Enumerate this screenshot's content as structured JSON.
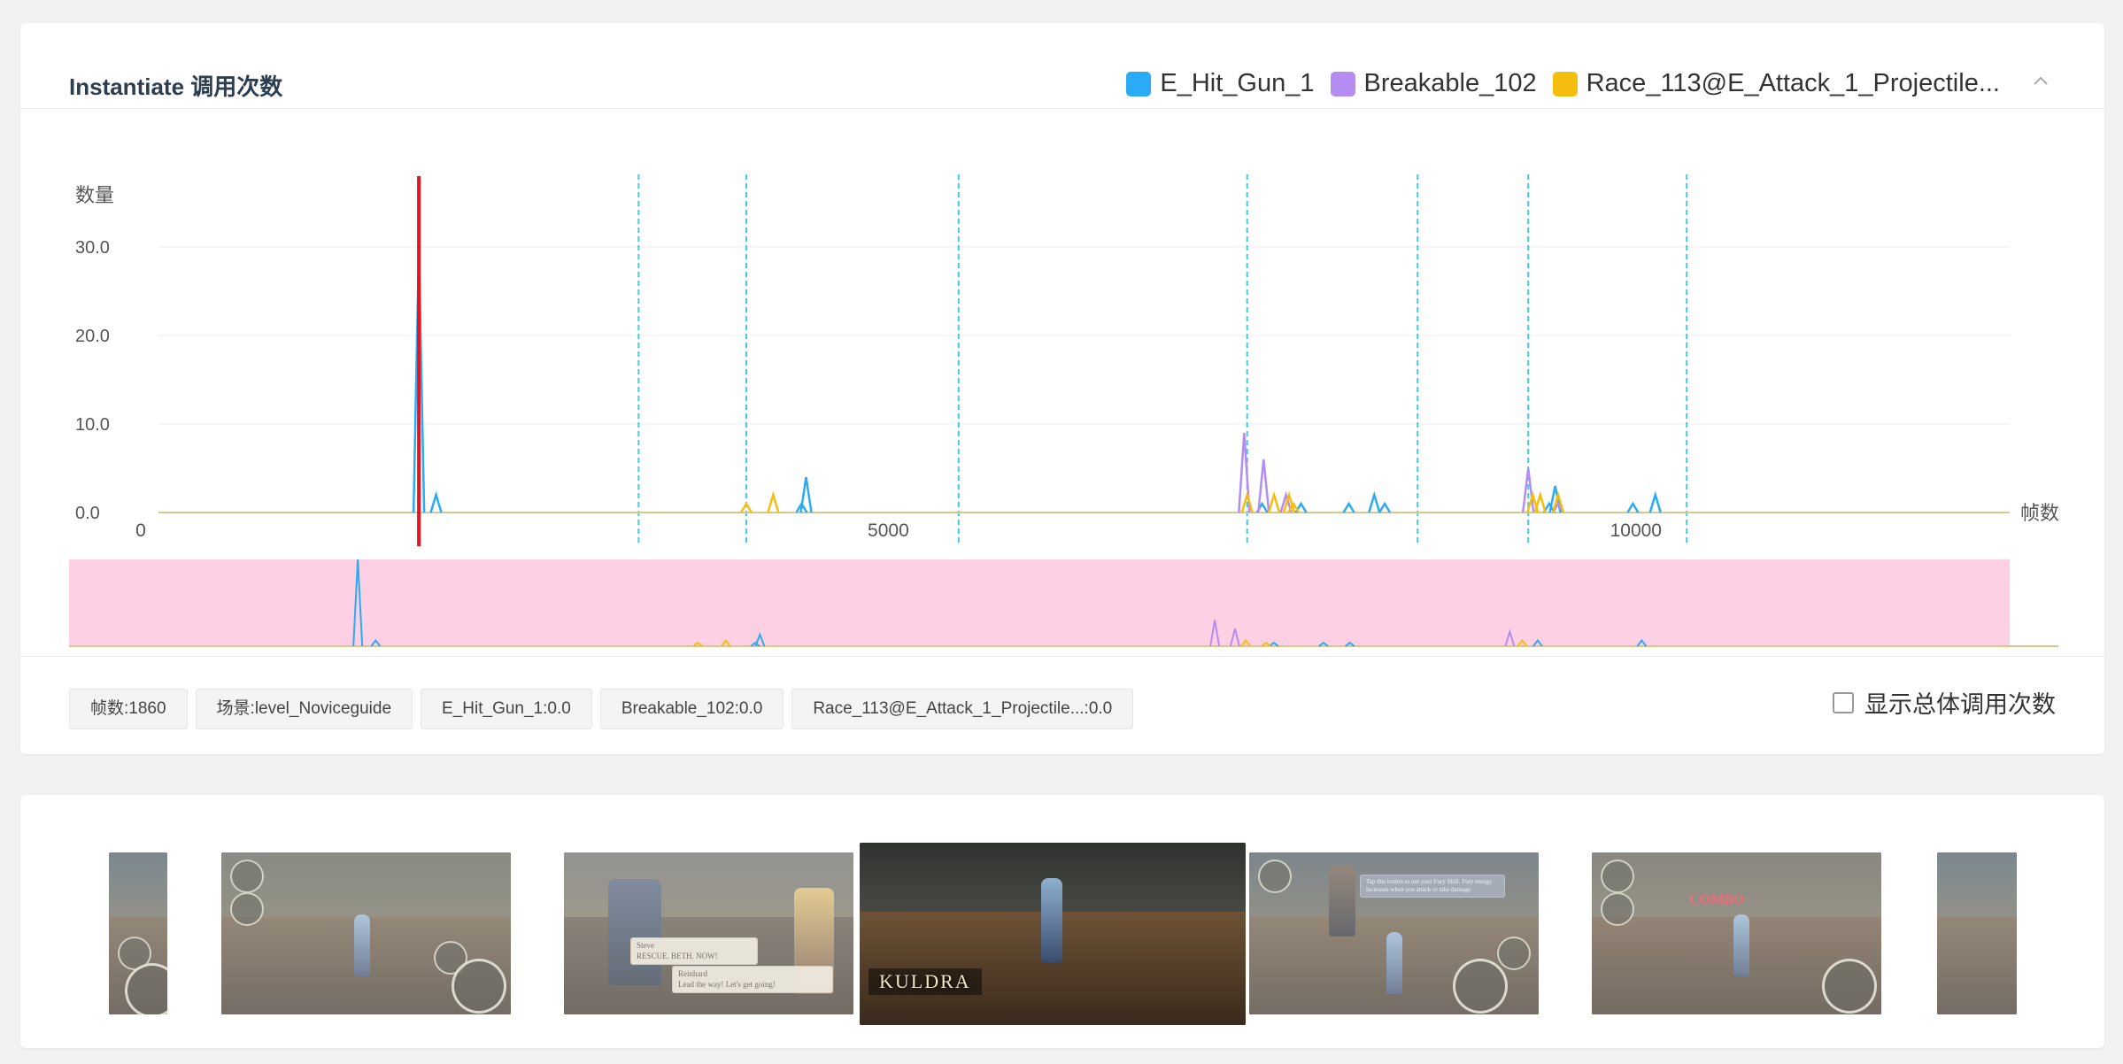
{
  "header": {
    "title": "Instantiate 调用次数",
    "legend": [
      {
        "label": "E_Hit_Gun_1",
        "color": "#29abf5"
      },
      {
        "label": "Breakable_102",
        "color": "#b48cf2"
      },
      {
        "label": "Race_113@E_Attack_1_Projectile...",
        "color": "#f5be0f"
      }
    ],
    "collapse_icon": "chevron-up-icon"
  },
  "chart_data": {
    "type": "line",
    "ylabel": "数量",
    "xlabel": "帧数",
    "xlim": [
      0,
      12500
    ],
    "ylim": [
      0,
      30
    ],
    "y_ticks": [
      "0.0",
      "10.0",
      "20.0",
      "30.0"
    ],
    "x_ticks": [
      "0",
      "5000",
      "10000"
    ],
    "x_tick_values": [
      0,
      5000,
      10000
    ],
    "y_tick_values": [
      0,
      10,
      20,
      30
    ],
    "cursor_frame": 1860,
    "markers": [
      3330,
      4050,
      5470,
      7400,
      8540,
      9280,
      10340
    ],
    "series": [
      {
        "name": "E_Hit_Gun_1",
        "color": "#29abf5",
        "points": [
          [
            1860,
            30
          ],
          [
            1975,
            2
          ],
          [
            4420,
            1
          ],
          [
            4450,
            4
          ],
          [
            7500,
            1
          ],
          [
            7760,
            1
          ],
          [
            8080,
            1
          ],
          [
            8250,
            2
          ],
          [
            8320,
            1
          ],
          [
            9420,
            1
          ],
          [
            9460,
            3
          ],
          [
            9980,
            1
          ],
          [
            10130,
            2
          ]
        ]
      },
      {
        "name": "Breakable_102",
        "color": "#b48cf2",
        "points": [
          [
            7380,
            9
          ],
          [
            7510,
            6
          ],
          [
            7660,
            2
          ],
          [
            9280,
            5
          ],
          [
            9480,
            1
          ]
        ]
      },
      {
        "name": "Race_113@E_Attack_1_Projectile...",
        "color": "#f5be0f",
        "points": [
          [
            4050,
            1
          ],
          [
            4230,
            2
          ],
          [
            7400,
            2
          ],
          [
            7580,
            2
          ],
          [
            7680,
            2
          ],
          [
            7710,
            1
          ],
          [
            9310,
            2
          ],
          [
            9360,
            2
          ],
          [
            9480,
            2
          ]
        ]
      }
    ],
    "overview": {
      "background": "#fdd0e3",
      "series_peaks": {
        "E_Hit_Gun_1": [
          [
            1860,
            30
          ],
          [
            1975,
            2
          ],
          [
            4420,
            1
          ],
          [
            4450,
            4
          ],
          [
            7760,
            1
          ],
          [
            8080,
            1
          ],
          [
            8250,
            1
          ],
          [
            9460,
            2
          ],
          [
            10130,
            2
          ]
        ],
        "Breakable_102": [
          [
            7380,
            9
          ],
          [
            7510,
            6
          ],
          [
            9280,
            5
          ]
        ],
        "Race_113@E_Attack_1_Projectile...": [
          [
            4050,
            1
          ],
          [
            4230,
            2
          ],
          [
            7580,
            2
          ],
          [
            7710,
            1
          ],
          [
            9360,
            2
          ]
        ]
      }
    }
  },
  "footer": {
    "tags": [
      "帧数:1860",
      "场景:level_Noviceguide",
      "E_Hit_Gun_1:0.0",
      "Breakable_102:0.0",
      "Race_113@E_Attack_1_Projectile...:0.0"
    ],
    "total_toggle_label": "显示总体调用次数",
    "total_toggle_checked": false
  },
  "thumbnails": {
    "dialog_1": {
      "speaker": "Steve",
      "text": "RESCUE. BETH. NOW!"
    },
    "dialog_2": {
      "speaker": "Reinhard",
      "text": "Lead the way! Let's get going!"
    },
    "banner": "KULDRA",
    "tip": "Tap this button to use your Fury Skill. Fury energy increases when you attack or take damage.",
    "combo": "COMBO"
  }
}
